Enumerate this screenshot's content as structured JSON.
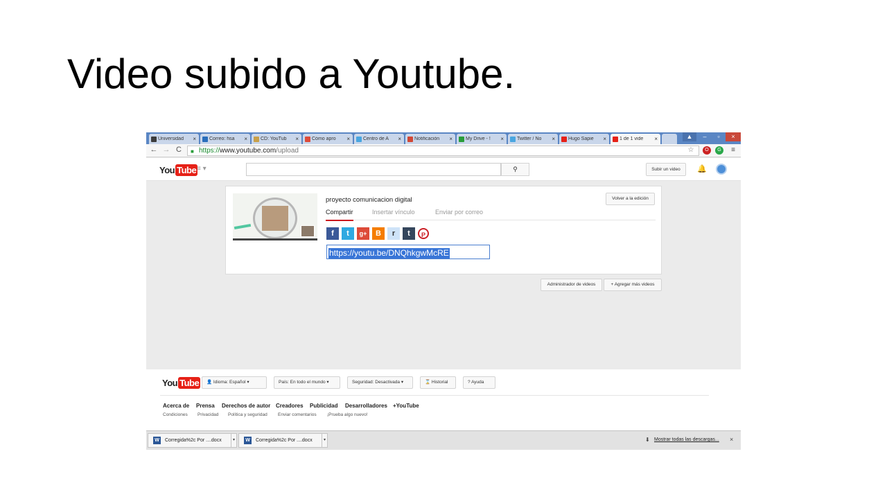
{
  "slide": {
    "title": "Video subido a Youtube."
  },
  "browser": {
    "tabs": [
      {
        "label": "Universidad",
        "icon": "graduation-cap-icon",
        "color": "#3c3c3c"
      },
      {
        "label": "Correo: hsa",
        "icon": "mail-icon",
        "color": "#2a6ebb"
      },
      {
        "label": "CD: YouTub",
        "icon": "folder-icon",
        "color": "#c8a04a"
      },
      {
        "label": "Cómo apro",
        "icon": "google-icon",
        "color": "#dd4b39"
      },
      {
        "label": "Centro de A",
        "icon": "twitter-icon",
        "color": "#4aa6e0"
      },
      {
        "label": "Notificación",
        "icon": "gmail-icon",
        "color": "#d14836"
      },
      {
        "label": "My Drive - !",
        "icon": "drive-icon",
        "color": "#2a9d3a"
      },
      {
        "label": "Twitter / No",
        "icon": "twitter-icon",
        "color": "#4aa6e0"
      },
      {
        "label": "Hugo Sapie",
        "icon": "youtube-icon",
        "color": "#e62117"
      },
      {
        "label": "1 de 1 vide",
        "icon": "youtube-icon",
        "color": "#e62117"
      }
    ],
    "url_scheme": "https://",
    "url_host": "www.youtube.com",
    "url_path": "/upload"
  },
  "youtube": {
    "logo_you": "You",
    "logo_tube": "Tube",
    "search_placeholder": "",
    "upload_button": "Subir un video"
  },
  "upload": {
    "video_title": "proyecto comunicacion digital",
    "tabs": [
      "Compartir",
      "Insertar vínculo",
      "Enviar por correo"
    ],
    "back_button": "Volver a la edición",
    "share_url": "https://youtu.be/DNQhkgwMcRE",
    "social": [
      {
        "name": "facebook-icon",
        "glyph": "f",
        "color": "#3b5998"
      },
      {
        "name": "twitter-icon",
        "glyph": "t",
        "color": "#2fa9e1"
      },
      {
        "name": "googleplus-icon",
        "glyph": "g+",
        "color": "#dd4b39"
      },
      {
        "name": "blogger-icon",
        "glyph": "B",
        "color": "#f57d00"
      },
      {
        "name": "reddit-icon",
        "glyph": "r",
        "color": "#cee3f8"
      },
      {
        "name": "tumblr-icon",
        "glyph": "t",
        "color": "#35465c"
      },
      {
        "name": "pinterest-icon",
        "glyph": "P",
        "color": "#cb2027"
      }
    ],
    "manager_button": "Administrador de videos",
    "add_more_button": "+ Agregar más videos"
  },
  "footer": {
    "language_button": "Idioma: Español",
    "country_button": "País: En todo el mundo",
    "safety_button": "Seguridad: Desactivada",
    "history_button": "Historial",
    "help_button": "Ayuda",
    "links": [
      "Acerca de",
      "Prensa",
      "Derechos de autor",
      "Creadores",
      "Publicidad",
      "Desarrolladores",
      "+YouTube"
    ],
    "sublinks": [
      "Condiciones",
      "Privacidad",
      "Política y seguridad",
      "Enviar comentarios",
      "¡Prueba algo nuevo!"
    ]
  },
  "downloads": {
    "items": [
      "Corregida%2c Por ....docx",
      "Corregida%2c Por ....docx"
    ],
    "show_all": "Mostrar todas las descargas..."
  }
}
